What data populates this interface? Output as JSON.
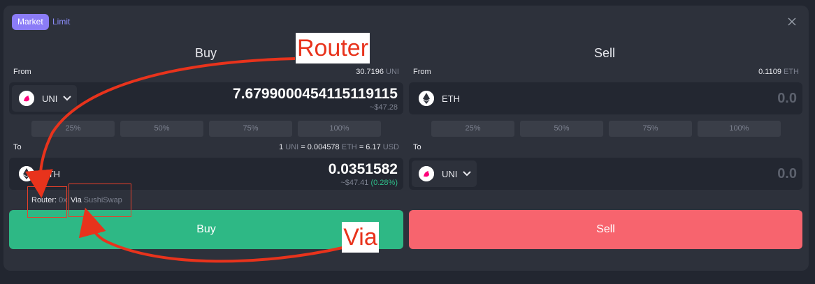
{
  "tabs": {
    "market": "Market",
    "limit": "Limit"
  },
  "buy": {
    "title": "Buy",
    "from_label": "From",
    "from_balance": "30.7196",
    "from_balance_unit": "UNI",
    "from_token": "UNI",
    "from_amount": "7.6799000454115119115",
    "from_usd": "~$47.28",
    "percentages": [
      "25%",
      "50%",
      "75%",
      "100%"
    ],
    "to_label": "To",
    "rate_a": "1",
    "rate_a_unit": "UNI",
    "rate_eq": "= 0.004578",
    "rate_b_unit": "ETH",
    "rate_eq2": "= 6.17",
    "rate_usd_unit": "USD",
    "to_token": "ETH",
    "to_amount": "0.0351582",
    "to_usd": "~$47.41",
    "to_change": "(0.28%)",
    "router_label": "Router:",
    "router_value": "0x",
    "via_label": "Via",
    "via_value": "SushiSwap",
    "button": "Buy"
  },
  "sell": {
    "title": "Sell",
    "from_label": "From",
    "from_balance": "0.1109",
    "from_balance_unit": "ETH",
    "from_token": "ETH",
    "from_amount": "0.0",
    "percentages": [
      "25%",
      "50%",
      "75%",
      "100%"
    ],
    "to_label": "To",
    "to_token": "UNI",
    "to_amount": "0.0",
    "button": "Sell"
  },
  "annotations": {
    "router": "Router",
    "via": "Via"
  },
  "colors": {
    "buy": "#2eb885",
    "sell": "#f7646e",
    "accent": "#8b7cf7",
    "annotation": "#e8331c"
  },
  "icons": {
    "uni": "uniswap-unicorn-icon",
    "eth": "ethereum-diamond-icon",
    "close": "close-icon",
    "chevron": "chevron-down-icon"
  }
}
